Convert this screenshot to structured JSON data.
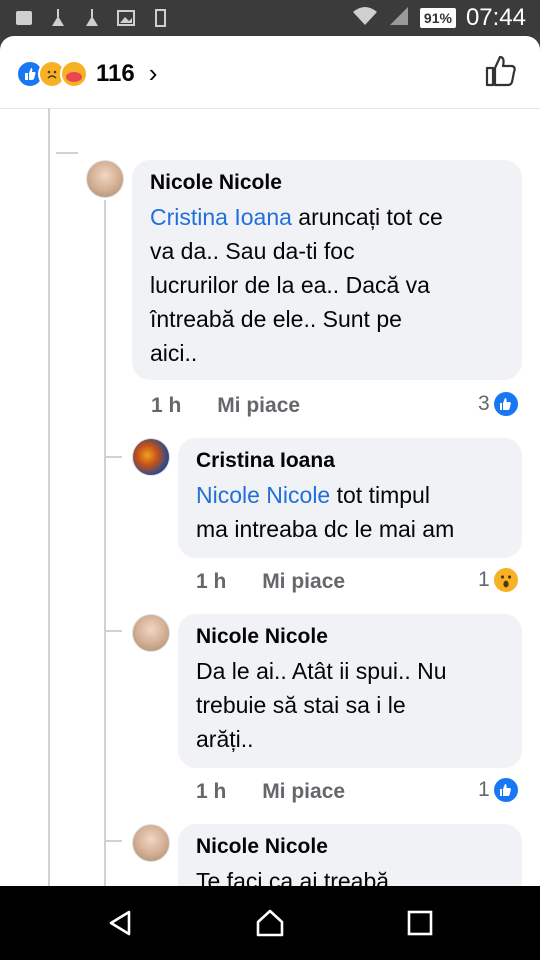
{
  "status_bar": {
    "battery": "91%",
    "time": "07:44"
  },
  "header": {
    "reaction_count": "116",
    "chevron": "›"
  },
  "comments": [
    {
      "name": "Nicole Nicole",
      "mention": "Cristina Ioana",
      "text_line1": " aruncați tot ce",
      "text_rest": [
        "va da.. Sau da-ti foc",
        "lucrurilor de la ea.. Dacă va",
        "întreabă de ele.. Sunt pe",
        "aici.."
      ],
      "time": "1 h",
      "like": "Mi piace",
      "reactions": "3"
    },
    {
      "name": "Cristina Ioana",
      "mention": "Nicole Nicole",
      "text_line1": " tot timpul",
      "text_rest": [
        "ma intreaba dc le mai am"
      ],
      "time": "1 h",
      "like": "Mi piace",
      "reactions": "1"
    },
    {
      "name": "Nicole Nicole",
      "text": [
        "Da le ai.. Atât ii spui.. Nu",
        "trebuie să stai sa i le",
        "arăți.."
      ],
      "time": "1 h",
      "like": "Mi piace",
      "reactions": "1"
    },
    {
      "name": "Nicole Nicole",
      "text": [
        "Te faci ca ai treabă.."
      ]
    }
  ]
}
